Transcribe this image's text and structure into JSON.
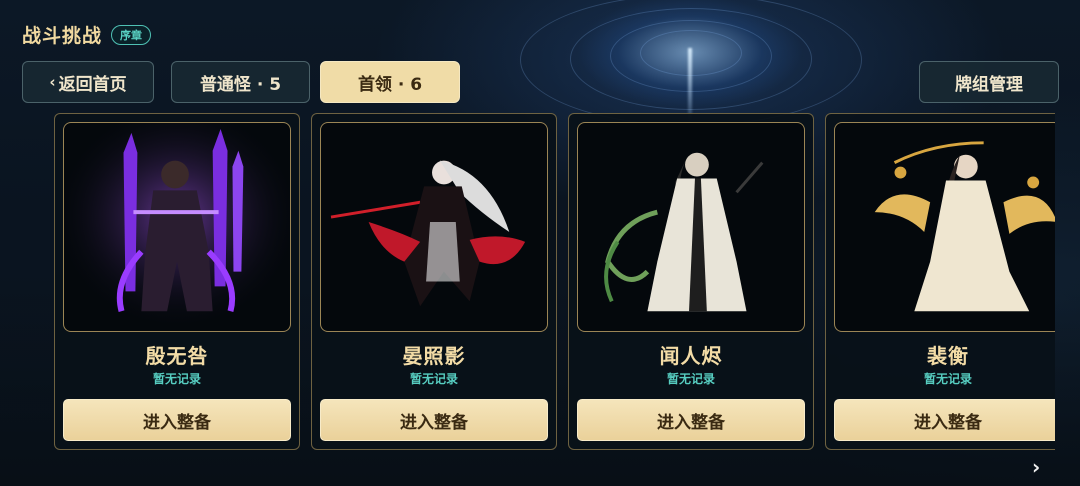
{
  "header": {
    "title": "战斗挑战",
    "chapter_badge": "序章"
  },
  "nav": {
    "back_label": "返回首页",
    "tabs": [
      {
        "label": "普通怪 · 5",
        "active": false
      },
      {
        "label": "首领 · 6",
        "active": true
      }
    ],
    "deck_label": "牌组管理"
  },
  "cards": [
    {
      "name": "殷无咎",
      "record": "暂无记录",
      "action": "进入整备",
      "theme": "#9a3cff"
    },
    {
      "name": "晏照影",
      "record": "暂无记录",
      "action": "进入整备",
      "theme": "#d11f2a"
    },
    {
      "name": "闻人烬",
      "record": "暂无记录",
      "action": "进入整备",
      "theme": "#6fa05a"
    },
    {
      "name": "裴衡",
      "record": "暂无记录",
      "action": "进入整备",
      "theme": "#e2b85c"
    }
  ],
  "colors": {
    "accent_gold": "#f0dca7",
    "record_teal": "#57cec1",
    "badge_teal": "#4fc1b4"
  },
  "icons": {
    "back": "chevron-left-icon",
    "next": "chevron-right-icon"
  }
}
